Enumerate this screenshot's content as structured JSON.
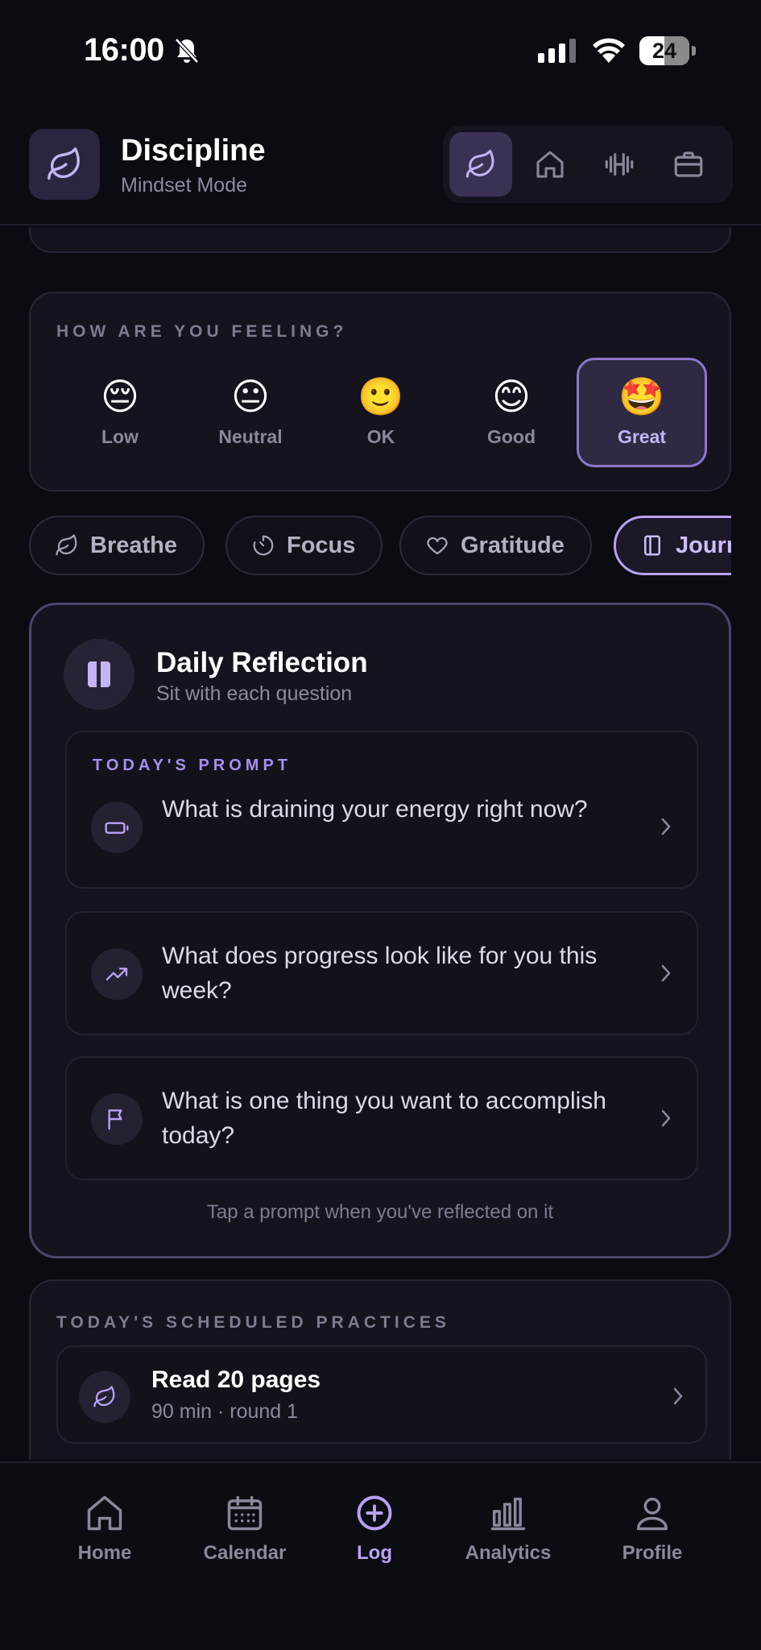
{
  "status_bar": {
    "time": "16:00",
    "battery": "24"
  },
  "header": {
    "title": "Discipline",
    "subtitle": "Mindset Mode",
    "modes": [
      "leaf-icon",
      "home-icon",
      "dumbbell-icon",
      "briefcase-icon"
    ],
    "active_mode": 0
  },
  "mood": {
    "label": "HOW ARE YOU FEELING?",
    "options": [
      {
        "emoji": "😔",
        "label": "Low"
      },
      {
        "emoji": "😐",
        "label": "Neutral"
      },
      {
        "emoji": "🙂",
        "label": "OK"
      },
      {
        "emoji": "😊",
        "label": "Good"
      },
      {
        "emoji": "🤩",
        "label": "Great"
      }
    ],
    "selected": "Great"
  },
  "chips": [
    {
      "icon": "leaf-icon",
      "label": "Breathe"
    },
    {
      "icon": "timer-icon",
      "label": "Focus"
    },
    {
      "icon": "heart-icon",
      "label": "Gratitude"
    },
    {
      "icon": "journal-icon",
      "label": "Journal",
      "active": true
    }
  ],
  "reflection": {
    "title": "Daily Reflection",
    "subtitle": "Sit with each question",
    "prompt_label": "TODAY'S PROMPT",
    "prompts": [
      {
        "icon": "battery-icon",
        "text": "What is draining your energy right now?"
      },
      {
        "icon": "trending-up-icon",
        "text": "What does progress look like for you this week?"
      },
      {
        "icon": "flag-icon",
        "text": "What is one thing you want to accomplish today?"
      }
    ],
    "footer": "Tap a prompt when you've reflected on it"
  },
  "scheduled": {
    "label": "TODAY'S SCHEDULED PRACTICES",
    "items": [
      {
        "icon": "leaf-icon",
        "title": "Read 20 pages",
        "meta": "90 min · round 1"
      }
    ]
  },
  "bottom_nav": {
    "items": [
      {
        "icon": "home-icon",
        "label": "Home"
      },
      {
        "icon": "calendar-icon",
        "label": "Calendar"
      },
      {
        "icon": "plus-circle-icon",
        "label": "Log"
      },
      {
        "icon": "bar-chart-icon",
        "label": "Analytics"
      },
      {
        "icon": "profile-icon",
        "label": "Profile"
      }
    ],
    "active": "Log"
  },
  "colors": {
    "background": "#0b0b12",
    "card": "#15141e",
    "accent": "#b9a2f2",
    "muted": "#8a889a"
  }
}
